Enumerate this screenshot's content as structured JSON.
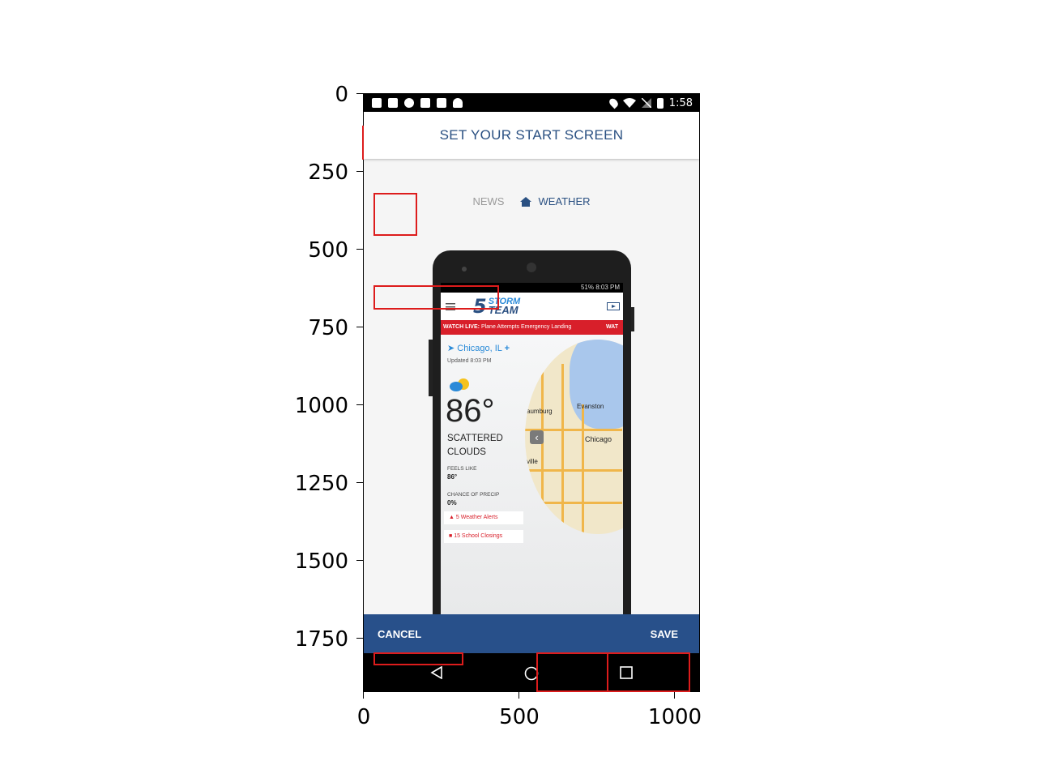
{
  "axes": {
    "y_ticks": [
      "0",
      "250",
      "500",
      "750",
      "1000",
      "1250",
      "1500",
      "1750"
    ],
    "x_ticks": [
      "0",
      "500",
      "1000"
    ]
  },
  "status_bar": {
    "time": "1:58",
    "left_icons": [
      "facebook-icon",
      "facebook-icon",
      "info-icon",
      "tools-icon",
      "lock-icon",
      "android-icon"
    ],
    "right_icons": [
      "location-icon",
      "wifi-icon",
      "no-signal-icon",
      "battery-icon"
    ]
  },
  "header": {
    "title": "SET YOUR START SCREEN"
  },
  "toggle": {
    "news_label": "NEWS",
    "weather_label": "WEATHER"
  },
  "preview": {
    "status_text": "51% 8:03 PM",
    "logo_number": "5",
    "logo_text_1": "STORM",
    "logo_text_2": "TEAM",
    "banner_live": "WATCH LIVE:",
    "banner_text": "Plane Attempts Emergency Landing",
    "banner_tail": "WAT",
    "location": "Chicago, IL",
    "updated": "Updated 8:03 PM",
    "temperature": "86°",
    "condition_line1": "SCATTERED",
    "condition_line2": "CLOUDS",
    "feels_like_label": "FEELS LIKE",
    "feels_like_value": "86°",
    "precip_label": "CHANCE OF PRECIP",
    "precip_value": "0%",
    "alerts": "5 Weather Alerts",
    "closings": "15 School Closings",
    "map_labels": [
      "Evanston",
      "Chicago",
      "aumburg",
      "ville"
    ]
  },
  "actions": {
    "cancel_label": "CANCEL",
    "save_label": "SAVE"
  },
  "colors": {
    "brand_blue": "#28508a",
    "alert_red": "#d81f2a",
    "annotation_red": "#dd1c1c"
  }
}
